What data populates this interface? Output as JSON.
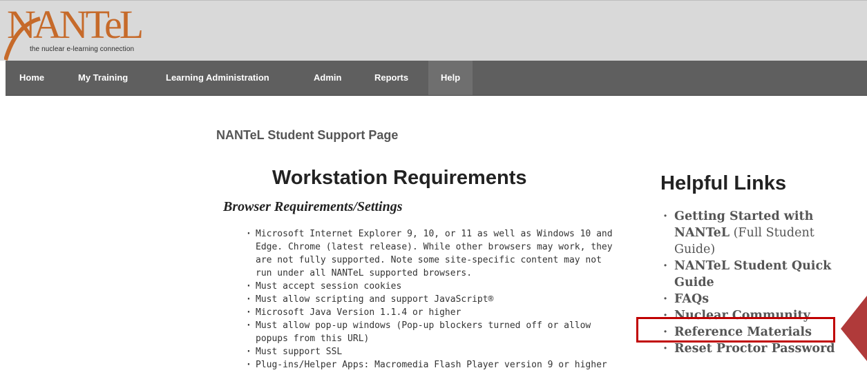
{
  "header": {
    "logo_text": "NANTeL",
    "logo_tagline": "the nuclear e-learning connection"
  },
  "nav": {
    "items": [
      {
        "label": "Home"
      },
      {
        "label": "My Training"
      },
      {
        "label": "Learning Administration"
      },
      {
        "label": "Admin"
      },
      {
        "label": "Reports"
      },
      {
        "label": "Help"
      }
    ],
    "active": "Help"
  },
  "main": {
    "page_heading": "NANTeL Student Support Page",
    "workstation_title": "Workstation Requirements",
    "browser_title": "Browser Requirements/Settings",
    "requirements": [
      "Microsoft Internet Explorer 9, 10, or 11 as well as Windows 10 and Edge. Chrome (latest release). While other browsers may work, they are not fully supported. Note some site-specific content may not run under all NANTeL supported browsers.",
      "Must accept session cookies",
      "Must allow scripting and support JavaScript®",
      "Microsoft Java Version 1.1.4 or higher",
      "Must allow pop-up windows (Pop-up blockers turned off or allow popups from this URL)",
      "Must support SSL",
      "Plug-ins/Helper Apps: Macromedia Flash Player version 9 or higher"
    ]
  },
  "helpful_links": {
    "title": "Helpful Links",
    "links": [
      {
        "bold": "Getting Started with NANTeL",
        "rest": " (Full Student Guide)"
      },
      {
        "bold": "NANTeL Student Quick Guide",
        "rest": ""
      },
      {
        "bold": "FAQs",
        "rest": ""
      },
      {
        "bold": "Nuclear Community",
        "rest": ""
      },
      {
        "bold": "Reference Materials",
        "rest": ""
      },
      {
        "bold": "Reset Proctor Password",
        "rest": ""
      }
    ]
  },
  "colors": {
    "highlight": "#c00000",
    "arrow": "#b03a3a",
    "nav_bg": "#5f5f5f",
    "logo": "#c66a2a"
  }
}
